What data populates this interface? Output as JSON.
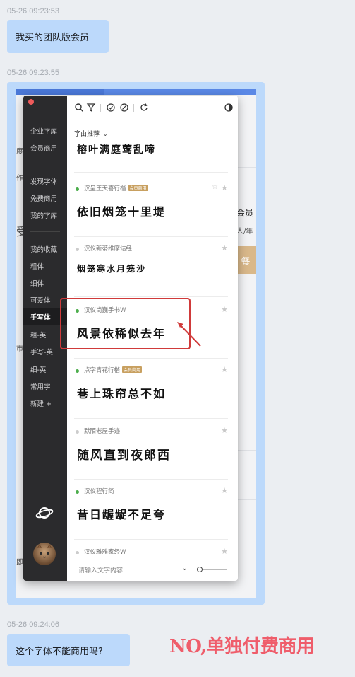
{
  "messages": [
    {
      "timestamp": "05-26 09:23:53",
      "text": "我买的团队版会员"
    },
    {
      "timestamp": "05-26 09:23:55"
    },
    {
      "timestamp": "05-26 09:24:06",
      "text": "这个字体不能商用吗?"
    }
  ],
  "annotation": {
    "text": "NO,单独付费商用",
    "color": "#ef5d6b"
  },
  "background_fragments": [
    "度",
    "作",
    "受",
    "会员",
    "人/年",
    "餐",
    "市",
    "即"
  ],
  "app": {
    "sidebar": {
      "top_items": [
        "企业字库",
        "会员商用"
      ],
      "mid_items": [
        "发现字体",
        "免费商用",
        "我的字库"
      ],
      "collection_items": [
        "我的收藏",
        "粗体",
        "细体",
        "可爱体",
        "手写体",
        "粗-英",
        "手写-英",
        "细-英",
        "常用字",
        "新建 +"
      ],
      "active_item": "手写体"
    },
    "toolbar_icons": [
      "search-icon",
      "filter-icon",
      "check-circle-icon",
      "slash-circle-icon",
      "refresh-icon",
      "theme-icon"
    ],
    "section_title": "字由推荐",
    "section_chevron": "⌄",
    "top_sample": "榕叶满庭莺乱啼",
    "fonts": [
      {
        "name": "汉呈王天喜行楷",
        "badge": "会员商用",
        "sample": "依旧烟笼十里堤",
        "status_color": "#4cae4c"
      },
      {
        "name": "汉仪新蒂维摩诘经",
        "badge": "",
        "sample": "烟笼寒水月笼沙",
        "status_color": "#cccccc"
      },
      {
        "name": "汉仪尚巍手书W",
        "badge": "",
        "sample": "风景依稀似去年",
        "status_color": "#4cae4c"
      },
      {
        "name": "点字青花行楷",
        "badge": "会员商用",
        "sample": "巷上珠帘总不如",
        "status_color": "#4cae4c"
      },
      {
        "name": "默陌老屋手迹",
        "badge": "",
        "sample": "随风直到夜郎西",
        "status_color": "#cccccc"
      },
      {
        "name": "汉仪程行简",
        "badge": "",
        "sample": "昔日龌龊不足夸",
        "status_color": "#4cae4c"
      },
      {
        "name": "汉仪雅雅家经W",
        "badge": "",
        "sample": "",
        "status_color": "#cccccc"
      }
    ],
    "bottom": {
      "placeholder": "请输入文字内容",
      "chevron": "⌄"
    }
  }
}
